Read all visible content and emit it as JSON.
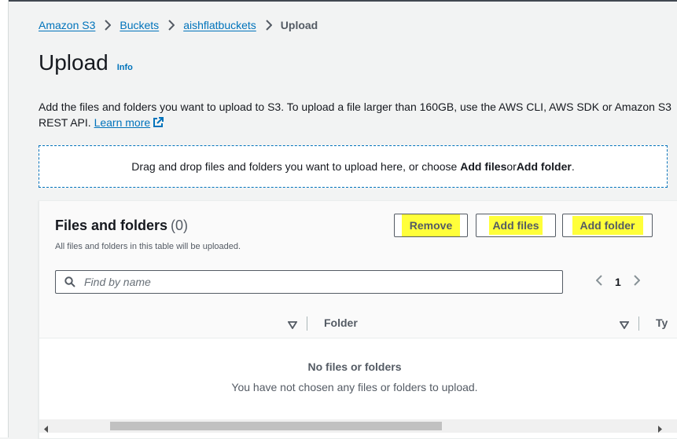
{
  "breadcrumb": {
    "items": [
      "Amazon S3",
      "Buckets",
      "aishflatbuckets"
    ],
    "current": "Upload"
  },
  "page": {
    "title": "Upload",
    "info": "Info",
    "description": "Add the files and folders you want to upload to S3. To upload a file larger than 160GB, use the AWS CLI, AWS SDK or Amazon S3 REST API.",
    "learn_more": "Learn more"
  },
  "dropzone": {
    "prefix": "Drag and drop files and folders you want to upload here, or choose ",
    "add_files": "Add files",
    "or": " or ",
    "add_folder": "Add folder",
    "suffix": "."
  },
  "files_panel": {
    "title": "Files and folders",
    "count": "(0)",
    "subtitle": "All files and folders in this table will be uploaded.",
    "buttons": {
      "remove": "Remove",
      "add_files": "Add files",
      "add_folder": "Add folder"
    },
    "search_placeholder": "Find by name",
    "pagination": {
      "page": "1"
    },
    "columns": [
      "Folder",
      "Ty"
    ],
    "empty_title": "No files or folders",
    "empty_subtitle": "You have not chosen any files or folders to upload."
  },
  "colors": {
    "link": "#0073bb",
    "highlight": "#ffff3a",
    "text": "#16191f",
    "muted": "#545b64"
  },
  "icons": [
    "chevron-right-icon",
    "external-link-icon",
    "search-icon",
    "chevron-left-icon",
    "sort-caret-icon",
    "scroll-left-icon",
    "scroll-right-icon"
  ]
}
